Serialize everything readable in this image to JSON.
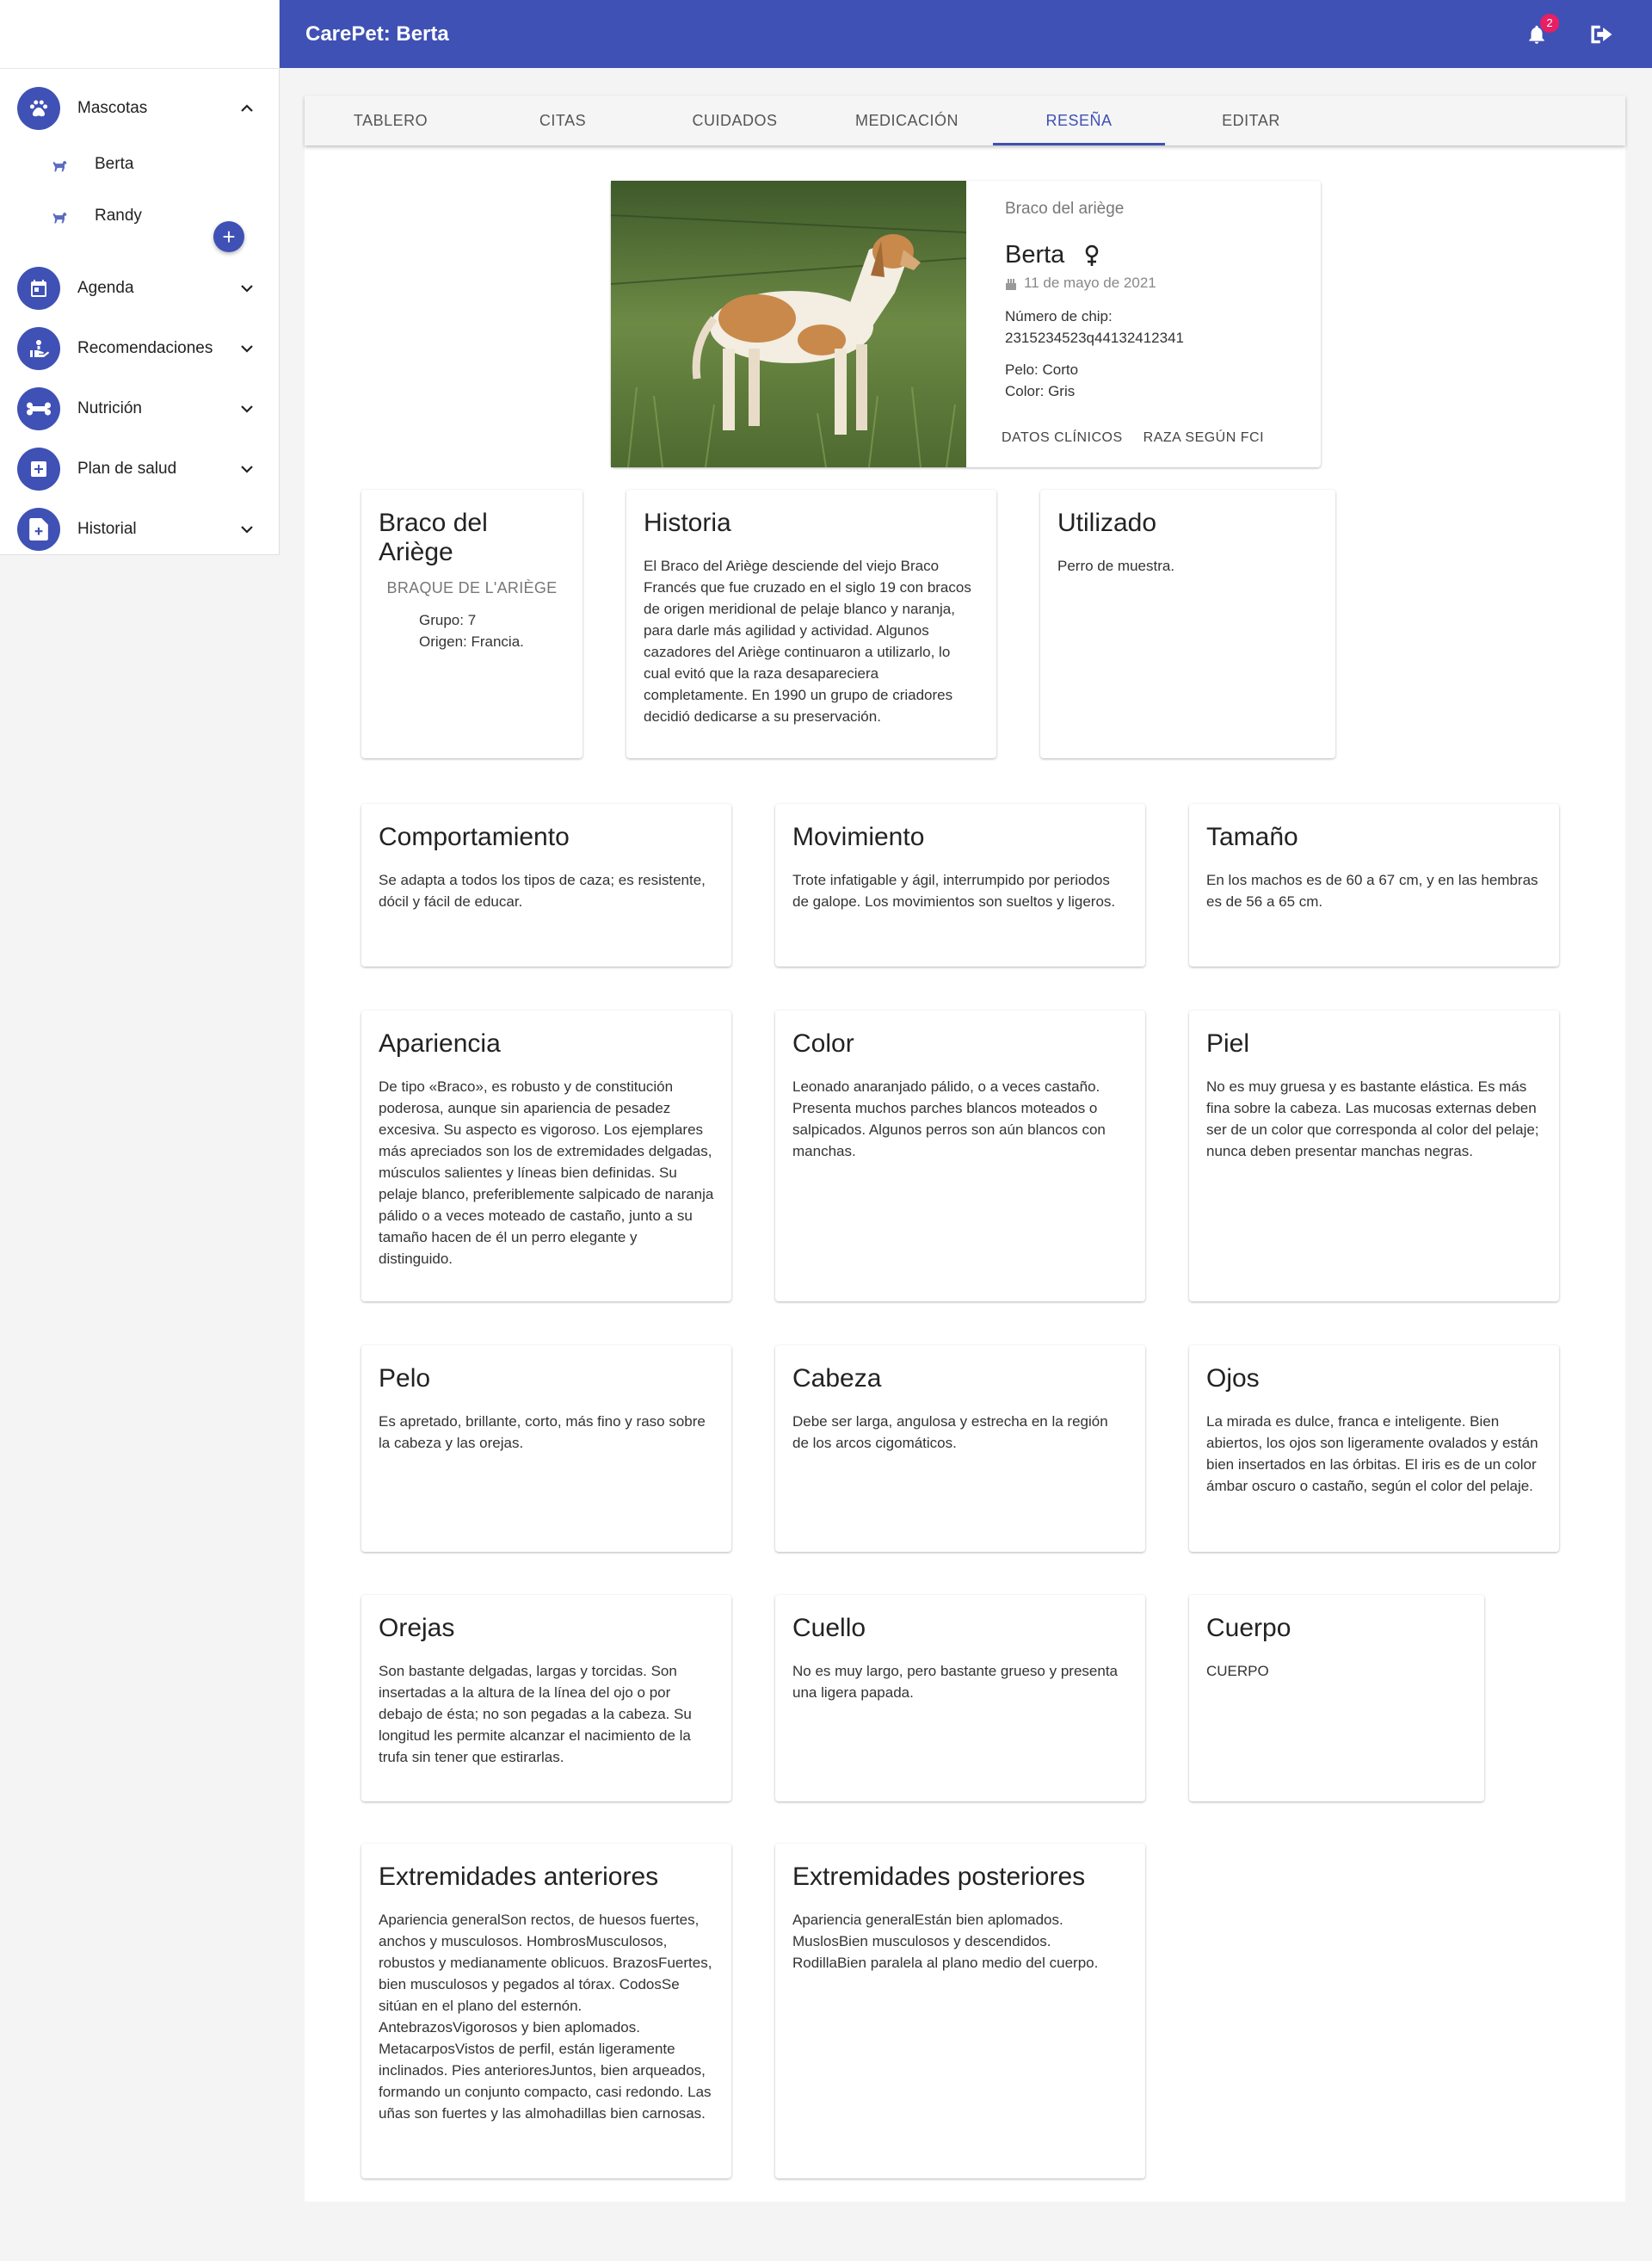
{
  "app": {
    "title": "CarePet: Berta",
    "notifications_count": "2"
  },
  "sidebar": {
    "mascotas": "Mascotas",
    "pets": [
      "Berta",
      "Randy"
    ],
    "add_label": "+",
    "items": [
      "Agenda",
      "Recomendaciones",
      "Nutrición",
      "Plan de salud",
      "Historial"
    ]
  },
  "tabs": [
    "TABLERO",
    "CITAS",
    "CUIDADOS",
    "MEDICACIÓN",
    "RESEÑA",
    "EDITAR"
  ],
  "active_tab": "RESEÑA",
  "profile": {
    "breed": "Braco del ariège",
    "name": "Berta",
    "birthday": "11 de mayo de 2021",
    "chip_label": "Número de chip:",
    "chip_value": "2315234523q44132412341",
    "pelo": "Pelo: Corto",
    "color": "Color: Gris",
    "btn_clinical": "DATOS CLÍNICOS",
    "btn_fci": "RAZA SEGÚN FCI"
  },
  "breed_card": {
    "title": "Braco del Ariège",
    "subtitle": "BRAQUE DE L'ARIÈGE",
    "grupo": "Grupo: 7",
    "origen": "Origen: Francia."
  },
  "sections": {
    "historia": {
      "title": "Historia",
      "text": "El Braco del Ariège desciende del viejo Braco Francés que fue cruzado en el siglo 19 con bracos de origen meridional de pelaje blanco y naranja, para darle más agilidad y actividad. Algunos cazadores del Ariège continuaron a utilizarlo, lo cual evitó que la raza desapareciera completamente. En 1990 un grupo de criadores decidió dedicarse a su preservación."
    },
    "utilizado": {
      "title": "Utilizado",
      "text": "Perro de muestra."
    },
    "comportamiento": {
      "title": "Comportamiento",
      "text": "Se adapta a todos los tipos de caza; es resistente, dócil y fácil de educar."
    },
    "movimiento": {
      "title": "Movimiento",
      "text": "Trote infatigable y ágil, interrumpido por periodos de galope. Los movimientos son sueltos y ligeros."
    },
    "tamano": {
      "title": "Tamaño",
      "text": "En los machos es de 60 a 67 cm, y en las hembras es de 56 a 65 cm."
    },
    "apariencia": {
      "title": "Apariencia",
      "text": "De tipo «Braco», es robusto y de constitución poderosa, aunque sin apariencia de pesadez excesiva. Su aspecto es vigoroso. Los ejemplares más apreciados son los de extremidades delgadas, músculos salientes y líneas bien definidas. Su pelaje blanco, preferiblemente salpicado de naranja pálido o a veces moteado de castaño, junto a su tamaño hacen de él un perro elegante y distinguido."
    },
    "color": {
      "title": "Color",
      "text": "Leonado anaranjado pálido, o a veces castaño. Presenta muchos parches blancos moteados o salpicados. Algunos perros son aún blancos con manchas."
    },
    "piel": {
      "title": "Piel",
      "text": "No es muy gruesa y es bastante elástica. Es más fina sobre la cabeza. Las mucosas externas deben ser de un color que corresponda al color del pelaje; nunca deben presentar manchas negras."
    },
    "pelo": {
      "title": "Pelo",
      "text": "Es apretado, brillante, corto, más fino y raso sobre la cabeza y las orejas."
    },
    "cabeza": {
      "title": "Cabeza",
      "text": "Debe ser larga, angulosa y estrecha en la región de los arcos cigomáticos."
    },
    "ojos": {
      "title": "Ojos",
      "text": "La mirada es dulce, franca e inteligente. Bien abiertos, los ojos son ligeramente ovalados y están bien insertados en las órbitas. El iris es de un color ámbar oscuro o castaño, según el color del pelaje."
    },
    "orejas": {
      "title": "Orejas",
      "text": "Son bastante delgadas, largas y torcidas. Son insertadas a la altura de la línea del ojo o por debajo de ésta; no son pegadas a la cabeza. Su longitud les permite alcanzar el nacimiento de la trufa sin tener que estirarlas."
    },
    "cuello": {
      "title": "Cuello",
      "text": "No es muy largo, pero bastante grueso y presenta una ligera papada."
    },
    "cuerpo": {
      "title": "Cuerpo",
      "text": "CUERPO"
    },
    "ext_anteriores": {
      "title": "Extremidades anteriores",
      "text": "Apariencia generalSon rectos, de huesos fuertes, anchos y musculosos. HombrosMusculosos, robustos y medianamente oblicuos. BrazosFuertes, bien musculosos y pegados al tórax. CodosSe sitúan en el plano del esternón. AntebrazosVigorosos y bien aplomados. MetacarposVistos de perfil, están ligeramente inclinados. Pies anterioresJuntos, bien arqueados, formando un conjunto compacto, casi redondo. Las uñas son fuertes y las almohadillas bien carnosas."
    },
    "ext_posteriores": {
      "title": "Extremidades posteriores",
      "text": "Apariencia generalEstán bien aplomados. MuslosBien musculosos y descendidos. RodillaBien paralela al plano medio del cuerpo."
    }
  },
  "colors": {
    "primary": "#3f51b5",
    "badge": "#e91e63"
  },
  "icons": [
    "bell-icon",
    "logout-icon",
    "paw-icon",
    "dog-icon",
    "calendar-icon",
    "hand-heart-icon",
    "bone-icon",
    "medical-plus-icon",
    "file-medical-icon",
    "chevron-up-icon",
    "chevron-down-icon",
    "female-icon",
    "cake-icon"
  ]
}
